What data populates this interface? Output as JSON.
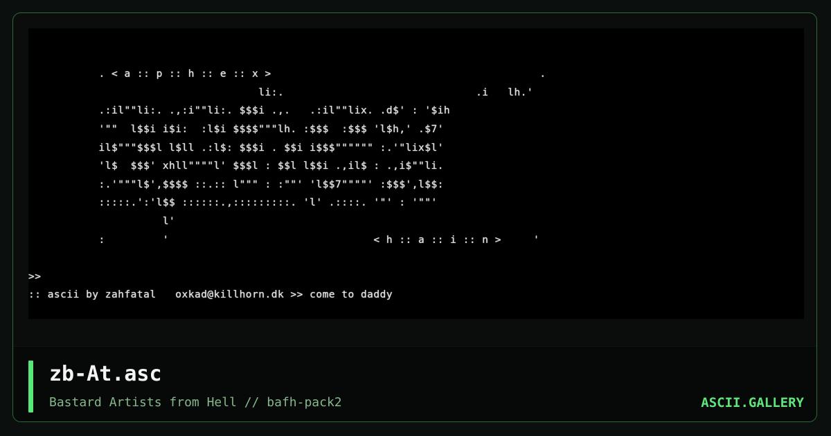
{
  "art": {
    "lines": [
      "",
      "",
      "           . < a :: p :: h :: e :: x >                                          .",
      "                                    li:.                              .i   lh.'",
      "           .:il\"\"li:. .,:i\"\"li:. $$$i .,.   .:il\"\"lix. .d$' : '$ih",
      "           '\"\"  l$$i i$i:  :l$i $$$$\"\"\"lh. :$$$  :$$$ 'l$h,' .$7'",
      "           il$\"\"\"$$$l l$ll .:l$: $$$i . $$i i$$$\"\"\"\"\"\" :.'\"lix$l'",
      "           'l$  $$$' xhll\"\"\"\"l' $$$l : $$l l$$i .,il$ : .,i$\"\"li.",
      "           :.'\"\"\"l$',$$$$ ::.:: l\"\"\" : :\"\"' 'l$$7\"\"\"\"' :$$$',l$$:",
      "           :::::.':'l$$ ::::::.,:::::::::. 'l' .::::. '\"' : '\"\"'",
      "                     l'",
      "           :         '                                < h :: a :: i :: n >     '",
      "",
      ">>",
      ":: ascii by zahfatal   oxkad@killhorn.dk >> come to daddy"
    ]
  },
  "file": {
    "name": "zb-At.asc",
    "subtitle": "Bastard Artists from Hell // bafh-pack2"
  },
  "site": {
    "brand": "ASCII.GALLERY"
  },
  "colors": {
    "accent": "#57e878",
    "frame_border": "#2f6b34",
    "subtitle": "#85b88c"
  }
}
